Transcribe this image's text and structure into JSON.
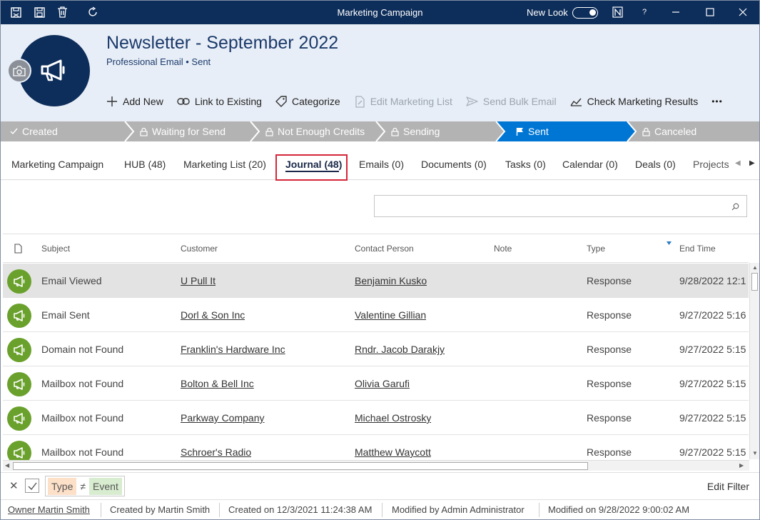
{
  "window": {
    "title": "Marketing Campaign",
    "new_look_label": "New Look",
    "help_label": "?"
  },
  "record": {
    "title": "Newsletter - September 2022",
    "subtitle": "Professional Email • Sent"
  },
  "toolbar": {
    "add_new": "Add New",
    "link_existing": "Link to Existing",
    "categorize": "Categorize",
    "edit_list": "Edit Marketing List",
    "send_bulk": "Send Bulk Email",
    "check_results": "Check Marketing Results",
    "more": "•••"
  },
  "stages": {
    "created": "Created",
    "waiting": "Waiting for Send",
    "credits": "Not Enough Credits",
    "sending": "Sending",
    "sent": "Sent",
    "canceled": "Canceled",
    "active_color": "#0076d4",
    "inactive_color": "#b3b3b3"
  },
  "tabs": {
    "campaign": "Marketing Campaign",
    "hub": "HUB (48)",
    "list": "Marketing List (20)",
    "journal": "Journal (48)",
    "emails": "Emails (0)",
    "documents": "Documents (0)",
    "tasks": "Tasks (0)",
    "calendar": "Calendar (0)",
    "deals": "Deals (0)",
    "projects": "Projects"
  },
  "grid": {
    "columns": {
      "subject": "Subject",
      "customer": "Customer",
      "contact": "Contact Person",
      "note": "Note",
      "type": "Type",
      "end_time": "End Time"
    },
    "rows": [
      {
        "subject": "Email Viewed",
        "customer": "U Pull It",
        "contact": "Benjamin Kusko",
        "note": "",
        "type": "Response",
        "end_time": "9/28/2022 12:1"
      },
      {
        "subject": "Email Sent",
        "customer": "Dorl & Son Inc",
        "contact": "Valentine Gillian",
        "note": "",
        "type": "Response",
        "end_time": "9/27/2022 5:16"
      },
      {
        "subject": "Domain not Found",
        "customer": "Franklin's Hardware Inc",
        "contact": "Rndr. Jacob Darakjy",
        "note": "",
        "type": "Response",
        "end_time": "9/27/2022 5:15"
      },
      {
        "subject": "Mailbox not Found",
        "customer": "Bolton & Bell Inc",
        "contact": "Olivia Garufi",
        "note": "",
        "type": "Response",
        "end_time": "9/27/2022 5:15"
      },
      {
        "subject": "Mailbox not Found",
        "customer": "Parkway Company",
        "contact": "Michael Ostrosky",
        "note": "",
        "type": "Response",
        "end_time": "9/27/2022 5:15"
      },
      {
        "subject": "Mailbox not Found",
        "customer": "Schroer's Radio",
        "contact": "Matthew Waycott",
        "note": "",
        "type": "Response",
        "end_time": "9/27/2022 5:15"
      }
    ]
  },
  "filter": {
    "field": "Type",
    "operator": "≠",
    "value": "Event",
    "edit_label": "Edit Filter"
  },
  "footer": {
    "owner": "Owner Martin Smith",
    "created_by": "Created by Martin Smith",
    "created_on": "Created on 12/3/2021 11:24:38 AM",
    "modified_by": "Modified by Admin Administrator",
    "modified_on": "Modified on 9/28/2022 9:00:02 AM"
  }
}
